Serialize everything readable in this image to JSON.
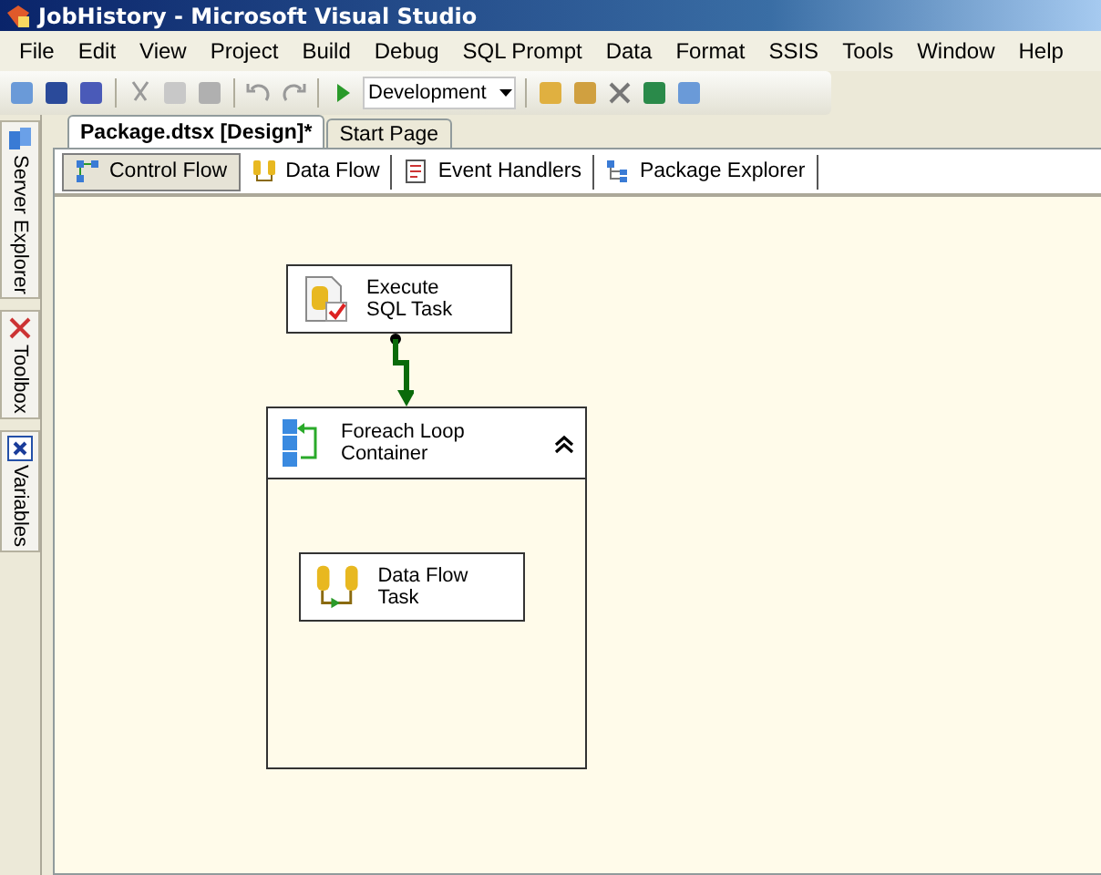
{
  "window": {
    "title": "JobHistory - Microsoft Visual Studio"
  },
  "menu": [
    "File",
    "Edit",
    "View",
    "Project",
    "Build",
    "Debug",
    "SQL Prompt",
    "Data",
    "Format",
    "SSIS",
    "Tools",
    "Window",
    "Help"
  ],
  "toolbar": {
    "configuration": "Development"
  },
  "side_panels": [
    {
      "label": "Server Explorer",
      "kind": "server"
    },
    {
      "label": "Toolbox",
      "kind": "toolbox"
    },
    {
      "label": "Variables",
      "kind": "variables"
    }
  ],
  "document_tabs": [
    {
      "label": "Package.dtsx [Design]*",
      "selected": true
    },
    {
      "label": "Start Page",
      "selected": false
    }
  ],
  "designer_tabs": [
    {
      "label": "Control Flow",
      "kind": "control",
      "selected": true
    },
    {
      "label": "Data Flow",
      "kind": "data",
      "selected": false
    },
    {
      "label": "Event Handlers",
      "kind": "events",
      "selected": false
    },
    {
      "label": "Package Explorer",
      "kind": "explorer",
      "selected": false
    }
  ],
  "canvas": {
    "task": {
      "label": "Execute SQL Task",
      "kind": "sql"
    },
    "container": {
      "label": "Foreach Loop Container",
      "expanded": true,
      "tasks": [
        {
          "label": "Data Flow Task",
          "kind": "dataflow"
        }
      ]
    }
  }
}
